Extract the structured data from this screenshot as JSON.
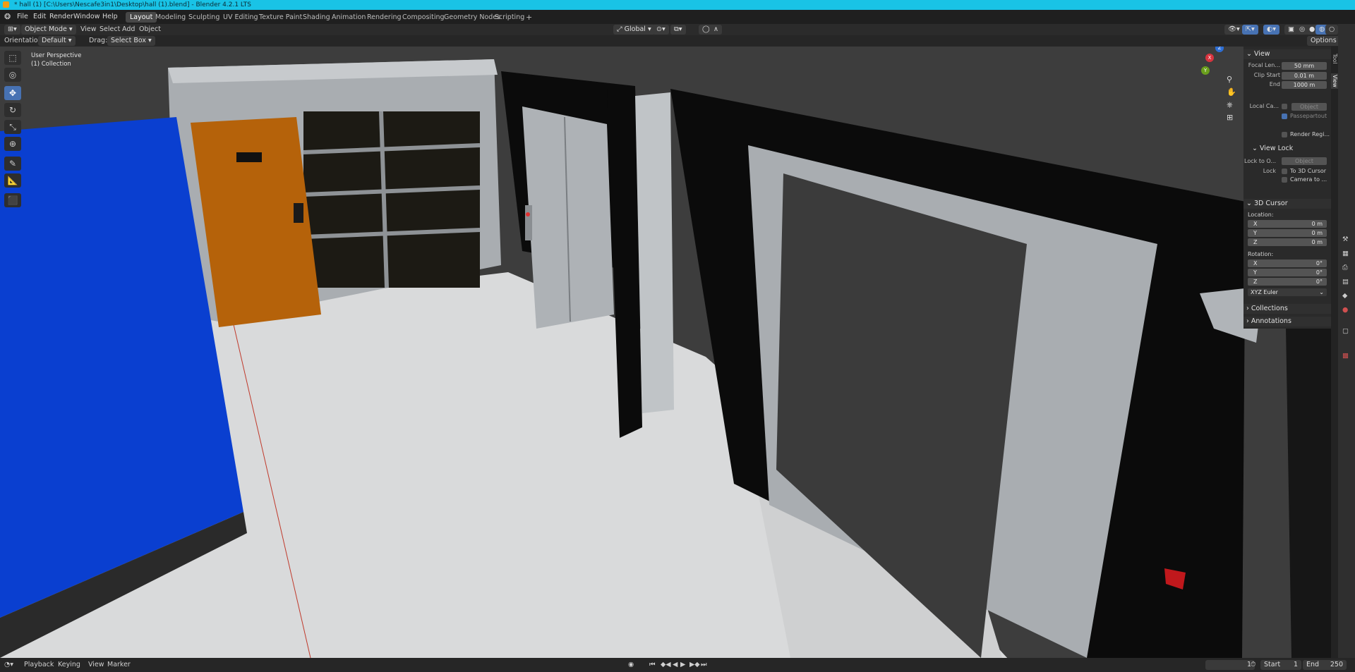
{
  "window": {
    "title": "* hall (1) [C:\\Users\\Nescafe3in1\\Desktop\\hall (1).blend] - Blender 4.2.1 LTS"
  },
  "menu": {
    "items": [
      "File",
      "Edit",
      "Render",
      "Window",
      "Help"
    ]
  },
  "workspaces": {
    "tabs": [
      "Layout",
      "Modeling",
      "Sculpting",
      "UV Editing",
      "Texture Paint",
      "Shading",
      "Animation",
      "Rendering",
      "Compositing",
      "Geometry Nodes",
      "Scripting"
    ],
    "add": "+",
    "active": "Layout"
  },
  "header": {
    "mode": "Object Mode",
    "menus": [
      "View",
      "Select",
      "Add",
      "Object"
    ],
    "transform_orientation": "Global",
    "options": "Options"
  },
  "tool_header": {
    "orientation_label": "Orientation:",
    "orientation_value": "Default",
    "drag_label": "Drag:",
    "drag_value": "Select Box"
  },
  "viewport": {
    "perspective": "User Perspective",
    "collection": "(1) Collection",
    "gizmo": {
      "x": "X",
      "y": "Y",
      "z": "Z"
    },
    "colors": {
      "wall_blue": "#0a3fd0",
      "door_orange": "#b5620a",
      "floor": "#d9dadb",
      "frame_black": "#0b0b0b",
      "wall_grey": "#a9adb1"
    }
  },
  "npanel": {
    "view": {
      "header": "View",
      "focal_length_label": "Focal Len...",
      "focal_length": "50 mm",
      "clip_start_label": "Clip Start",
      "clip_start": "0.01 m",
      "end_label": "End",
      "end": "1000 m",
      "local_camera_label": "Local Ca...",
      "local_camera_value": "Object",
      "passepartout": "Passepartout",
      "render_region": "Render Regi..."
    },
    "view_lock": {
      "header": "View Lock",
      "lock_to_label": "Lock to O...",
      "lock_to_value": "Object",
      "lock_label": "Lock",
      "to_3d_cursor": "To 3D Cursor",
      "camera_to": "Camera to ..."
    },
    "cursor": {
      "header": "3D Cursor",
      "location_label": "Location:",
      "loc": [
        {
          "axis": "X",
          "value": "0 m"
        },
        {
          "axis": "Y",
          "value": "0 m"
        },
        {
          "axis": "Z",
          "value": "0 m"
        }
      ],
      "rotation_label": "Rotation:",
      "rot": [
        {
          "axis": "X",
          "value": "0°"
        },
        {
          "axis": "Y",
          "value": "0°"
        },
        {
          "axis": "Z",
          "value": "0°"
        }
      ],
      "rotation_mode": "XYZ Euler"
    },
    "collections": "Collections",
    "annotations": "Annotations"
  },
  "sidetabs": {
    "tool": "Tool",
    "view": "View"
  },
  "timeline": {
    "menus": [
      "Playback",
      "Keying",
      "View",
      "Marker"
    ],
    "current_frame": "1",
    "start_label": "Start",
    "start": "1",
    "end_label": "End",
    "end": "250"
  }
}
